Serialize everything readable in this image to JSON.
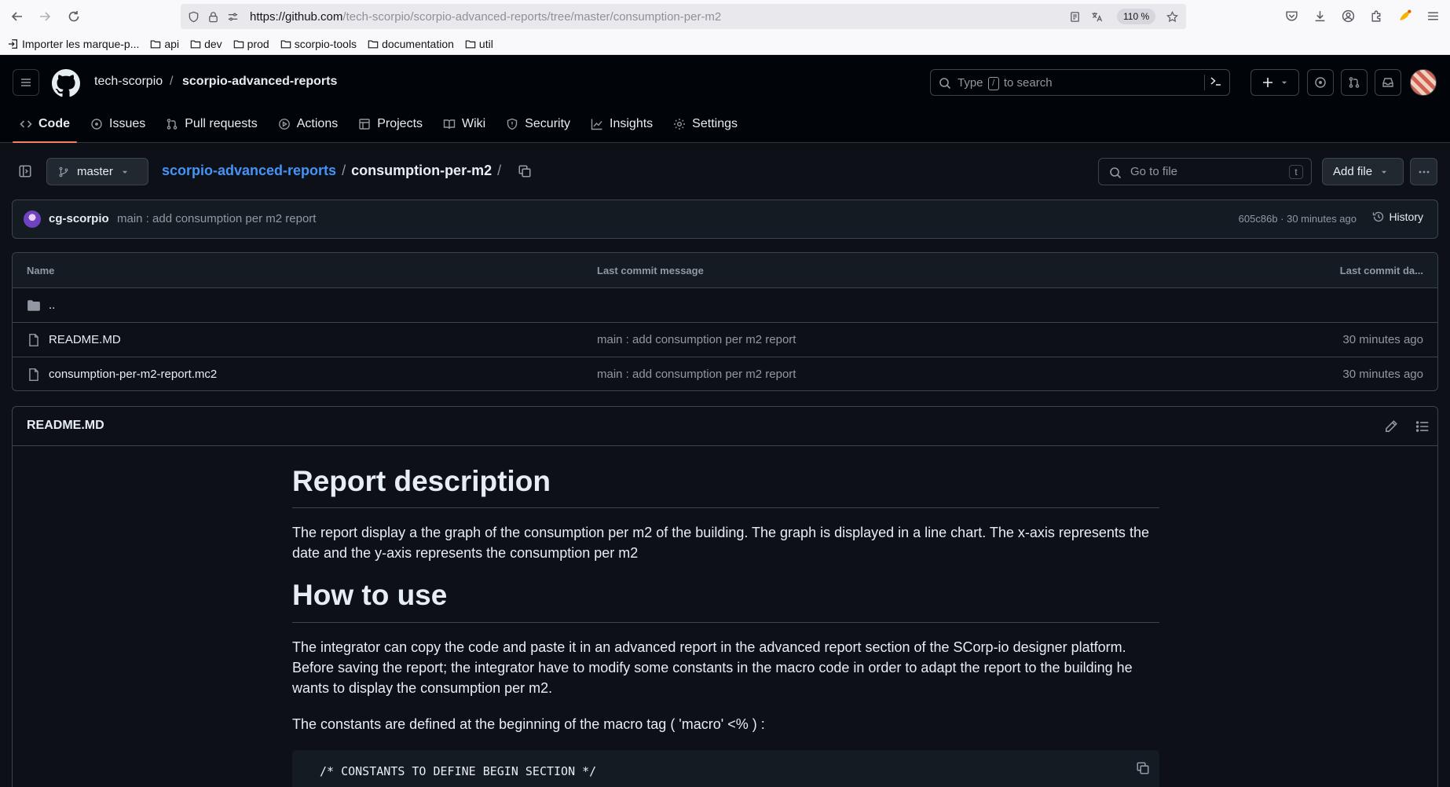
{
  "browser": {
    "url_host": "https://github.com",
    "url_path": "/tech-scorpio/scorpio-advanced-reports/tree/master/consumption-per-m2",
    "zoom": "110 %",
    "bookmarks": [
      {
        "label": "Importer les marque-p..."
      },
      {
        "label": "api"
      },
      {
        "label": "dev"
      },
      {
        "label": "prod"
      },
      {
        "label": "scorpio-tools"
      },
      {
        "label": "documentation"
      },
      {
        "label": "util"
      }
    ]
  },
  "header": {
    "owner": "tech-scorpio",
    "separator": "/",
    "repo": "scorpio-advanced-reports",
    "search_prefix": "Type",
    "search_key": "/",
    "search_suffix": "to search"
  },
  "tabs": [
    {
      "label": "Code",
      "icon": "code-icon"
    },
    {
      "label": "Issues",
      "icon": "issue-icon"
    },
    {
      "label": "Pull requests",
      "icon": "pull-request-icon"
    },
    {
      "label": "Actions",
      "icon": "play-icon"
    },
    {
      "label": "Projects",
      "icon": "table-icon"
    },
    {
      "label": "Wiki",
      "icon": "book-icon"
    },
    {
      "label": "Security",
      "icon": "shield-icon"
    },
    {
      "label": "Insights",
      "icon": "graph-icon"
    },
    {
      "label": "Settings",
      "icon": "gear-icon"
    }
  ],
  "filenav": {
    "branch": "master",
    "path_repo": "scorpio-advanced-reports",
    "path_sep": "/",
    "path_dir": "consumption-per-m2",
    "path_trailing": "/",
    "goto_placeholder": "Go to file",
    "goto_key": "t",
    "add_file": "Add file"
  },
  "commit": {
    "author": "cg-scorpio",
    "message": "main : add consumption per m2 report",
    "meta": "605c86b · 30 minutes ago",
    "history": "History"
  },
  "files": {
    "columns": {
      "name": "Name",
      "message": "Last commit message",
      "date": "Last commit da..."
    },
    "parent": "..",
    "rows": [
      {
        "name": "README.MD",
        "message": "main : add consumption per m2 report",
        "date": "30 minutes ago"
      },
      {
        "name": "consumption-per-m2-report.mc2",
        "message": "main : add consumption per m2 report",
        "date": "30 minutes ago"
      }
    ]
  },
  "readme": {
    "title": "README.MD",
    "h1_description": "Report description",
    "p_description": "The report display a the graph of the consumption per m2 of the building. The graph is displayed in a line chart. The x-axis represents the date and the y-axis represents the consumption per m2",
    "h1_usage": "How to use",
    "p_usage": "The integrator can copy the code and paste it in an advanced report in the advanced report section of the SCorp-io designer platform. Before saving the report; the integrator have to modify some constants in the macro code in order to adapt the report to the building he wants to display the consumption per m2.",
    "p_constants": "The constants are defined at the beginning of the macro tag ( 'macro' <% ) :",
    "code_line": "/* CONSTANTS TO DEFINE BEGIN SECTION */"
  }
}
